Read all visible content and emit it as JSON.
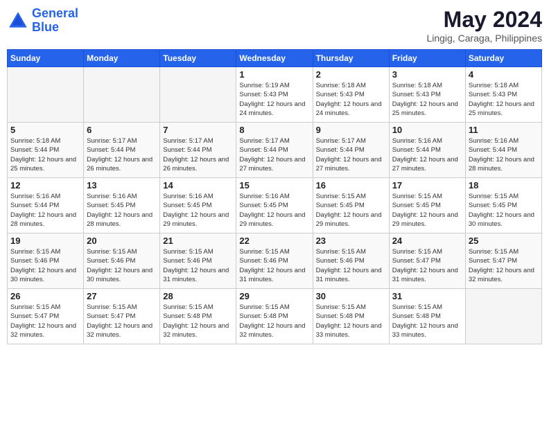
{
  "header": {
    "logo_line1": "General",
    "logo_line2": "Blue",
    "month": "May 2024",
    "location": "Lingig, Caraga, Philippines"
  },
  "weekdays": [
    "Sunday",
    "Monday",
    "Tuesday",
    "Wednesday",
    "Thursday",
    "Friday",
    "Saturday"
  ],
  "weeks": [
    [
      {
        "day": "",
        "sunrise": "",
        "sunset": "",
        "daylight": "",
        "empty": true
      },
      {
        "day": "",
        "sunrise": "",
        "sunset": "",
        "daylight": "",
        "empty": true
      },
      {
        "day": "",
        "sunrise": "",
        "sunset": "",
        "daylight": "",
        "empty": true
      },
      {
        "day": "1",
        "sunrise": "Sunrise: 5:19 AM",
        "sunset": "Sunset: 5:43 PM",
        "daylight": "Daylight: 12 hours and 24 minutes.",
        "empty": false
      },
      {
        "day": "2",
        "sunrise": "Sunrise: 5:18 AM",
        "sunset": "Sunset: 5:43 PM",
        "daylight": "Daylight: 12 hours and 24 minutes.",
        "empty": false
      },
      {
        "day": "3",
        "sunrise": "Sunrise: 5:18 AM",
        "sunset": "Sunset: 5:43 PM",
        "daylight": "Daylight: 12 hours and 25 minutes.",
        "empty": false
      },
      {
        "day": "4",
        "sunrise": "Sunrise: 5:18 AM",
        "sunset": "Sunset: 5:43 PM",
        "daylight": "Daylight: 12 hours and 25 minutes.",
        "empty": false
      }
    ],
    [
      {
        "day": "5",
        "sunrise": "Sunrise: 5:18 AM",
        "sunset": "Sunset: 5:44 PM",
        "daylight": "Daylight: 12 hours and 25 minutes.",
        "empty": false
      },
      {
        "day": "6",
        "sunrise": "Sunrise: 5:17 AM",
        "sunset": "Sunset: 5:44 PM",
        "daylight": "Daylight: 12 hours and 26 minutes.",
        "empty": false
      },
      {
        "day": "7",
        "sunrise": "Sunrise: 5:17 AM",
        "sunset": "Sunset: 5:44 PM",
        "daylight": "Daylight: 12 hours and 26 minutes.",
        "empty": false
      },
      {
        "day": "8",
        "sunrise": "Sunrise: 5:17 AM",
        "sunset": "Sunset: 5:44 PM",
        "daylight": "Daylight: 12 hours and 27 minutes.",
        "empty": false
      },
      {
        "day": "9",
        "sunrise": "Sunrise: 5:17 AM",
        "sunset": "Sunset: 5:44 PM",
        "daylight": "Daylight: 12 hours and 27 minutes.",
        "empty": false
      },
      {
        "day": "10",
        "sunrise": "Sunrise: 5:16 AM",
        "sunset": "Sunset: 5:44 PM",
        "daylight": "Daylight: 12 hours and 27 minutes.",
        "empty": false
      },
      {
        "day": "11",
        "sunrise": "Sunrise: 5:16 AM",
        "sunset": "Sunset: 5:44 PM",
        "daylight": "Daylight: 12 hours and 28 minutes.",
        "empty": false
      }
    ],
    [
      {
        "day": "12",
        "sunrise": "Sunrise: 5:16 AM",
        "sunset": "Sunset: 5:44 PM",
        "daylight": "Daylight: 12 hours and 28 minutes.",
        "empty": false
      },
      {
        "day": "13",
        "sunrise": "Sunrise: 5:16 AM",
        "sunset": "Sunset: 5:45 PM",
        "daylight": "Daylight: 12 hours and 28 minutes.",
        "empty": false
      },
      {
        "day": "14",
        "sunrise": "Sunrise: 5:16 AM",
        "sunset": "Sunset: 5:45 PM",
        "daylight": "Daylight: 12 hours and 29 minutes.",
        "empty": false
      },
      {
        "day": "15",
        "sunrise": "Sunrise: 5:16 AM",
        "sunset": "Sunset: 5:45 PM",
        "daylight": "Daylight: 12 hours and 29 minutes.",
        "empty": false
      },
      {
        "day": "16",
        "sunrise": "Sunrise: 5:15 AM",
        "sunset": "Sunset: 5:45 PM",
        "daylight": "Daylight: 12 hours and 29 minutes.",
        "empty": false
      },
      {
        "day": "17",
        "sunrise": "Sunrise: 5:15 AM",
        "sunset": "Sunset: 5:45 PM",
        "daylight": "Daylight: 12 hours and 29 minutes.",
        "empty": false
      },
      {
        "day": "18",
        "sunrise": "Sunrise: 5:15 AM",
        "sunset": "Sunset: 5:45 PM",
        "daylight": "Daylight: 12 hours and 30 minutes.",
        "empty": false
      }
    ],
    [
      {
        "day": "19",
        "sunrise": "Sunrise: 5:15 AM",
        "sunset": "Sunset: 5:46 PM",
        "daylight": "Daylight: 12 hours and 30 minutes.",
        "empty": false
      },
      {
        "day": "20",
        "sunrise": "Sunrise: 5:15 AM",
        "sunset": "Sunset: 5:46 PM",
        "daylight": "Daylight: 12 hours and 30 minutes.",
        "empty": false
      },
      {
        "day": "21",
        "sunrise": "Sunrise: 5:15 AM",
        "sunset": "Sunset: 5:46 PM",
        "daylight": "Daylight: 12 hours and 31 minutes.",
        "empty": false
      },
      {
        "day": "22",
        "sunrise": "Sunrise: 5:15 AM",
        "sunset": "Sunset: 5:46 PM",
        "daylight": "Daylight: 12 hours and 31 minutes.",
        "empty": false
      },
      {
        "day": "23",
        "sunrise": "Sunrise: 5:15 AM",
        "sunset": "Sunset: 5:46 PM",
        "daylight": "Daylight: 12 hours and 31 minutes.",
        "empty": false
      },
      {
        "day": "24",
        "sunrise": "Sunrise: 5:15 AM",
        "sunset": "Sunset: 5:47 PM",
        "daylight": "Daylight: 12 hours and 31 minutes.",
        "empty": false
      },
      {
        "day": "25",
        "sunrise": "Sunrise: 5:15 AM",
        "sunset": "Sunset: 5:47 PM",
        "daylight": "Daylight: 12 hours and 32 minutes.",
        "empty": false
      }
    ],
    [
      {
        "day": "26",
        "sunrise": "Sunrise: 5:15 AM",
        "sunset": "Sunset: 5:47 PM",
        "daylight": "Daylight: 12 hours and 32 minutes.",
        "empty": false
      },
      {
        "day": "27",
        "sunrise": "Sunrise: 5:15 AM",
        "sunset": "Sunset: 5:47 PM",
        "daylight": "Daylight: 12 hours and 32 minutes.",
        "empty": false
      },
      {
        "day": "28",
        "sunrise": "Sunrise: 5:15 AM",
        "sunset": "Sunset: 5:48 PM",
        "daylight": "Daylight: 12 hours and 32 minutes.",
        "empty": false
      },
      {
        "day": "29",
        "sunrise": "Sunrise: 5:15 AM",
        "sunset": "Sunset: 5:48 PM",
        "daylight": "Daylight: 12 hours and 32 minutes.",
        "empty": false
      },
      {
        "day": "30",
        "sunrise": "Sunrise: 5:15 AM",
        "sunset": "Sunset: 5:48 PM",
        "daylight": "Daylight: 12 hours and 33 minutes.",
        "empty": false
      },
      {
        "day": "31",
        "sunrise": "Sunrise: 5:15 AM",
        "sunset": "Sunset: 5:48 PM",
        "daylight": "Daylight: 12 hours and 33 minutes.",
        "empty": false
      },
      {
        "day": "",
        "sunrise": "",
        "sunset": "",
        "daylight": "",
        "empty": true
      }
    ]
  ]
}
